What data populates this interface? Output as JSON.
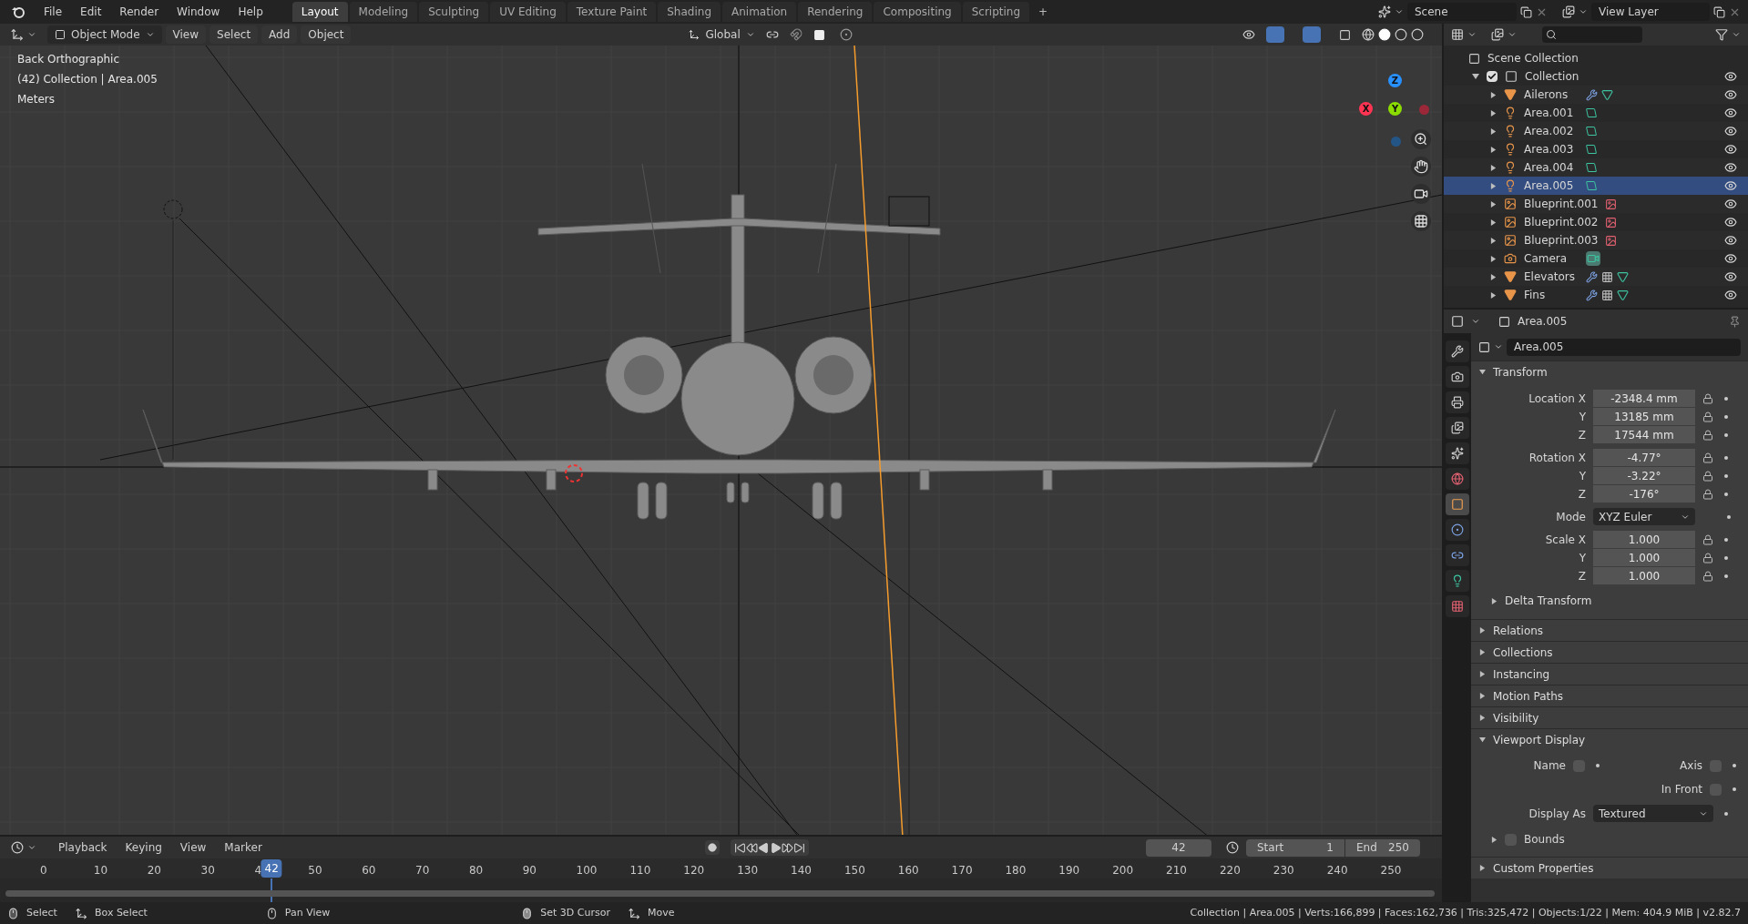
{
  "top_bar": {
    "menus": [
      "File",
      "Edit",
      "Render",
      "Window",
      "Help"
    ],
    "workspaces": [
      {
        "label": "Layout",
        "selected": true
      },
      {
        "label": "Modeling",
        "selected": false
      },
      {
        "label": "Sculpting",
        "selected": false
      },
      {
        "label": "UV Editing",
        "selected": false
      },
      {
        "label": "Texture Paint",
        "selected": false
      },
      {
        "label": "Shading",
        "selected": false
      },
      {
        "label": "Animation",
        "selected": false
      },
      {
        "label": "Rendering",
        "selected": false
      },
      {
        "label": "Compositing",
        "selected": false
      },
      {
        "label": "Scripting",
        "selected": false
      }
    ],
    "add_tab": "+",
    "scene": "Scene",
    "view_layer": "View Layer"
  },
  "viewport": {
    "mode": "Object Mode",
    "menus": [
      "View",
      "Select",
      "Add",
      "Object"
    ],
    "orientation": "Global",
    "overlay_text": [
      "Back Orthographic",
      "(42) Collection | Area.005",
      "Meters"
    ],
    "gizmo_axes": [
      "X",
      "Y",
      "Z"
    ]
  },
  "outliner": {
    "root": "Scene Collection",
    "collection": {
      "name": "Collection",
      "checked": true,
      "expanded": true,
      "children": [
        {
          "name": "Ailerons",
          "kind": "mesh",
          "selected": false,
          "visible": true
        },
        {
          "name": "Area.001",
          "kind": "light",
          "selected": false,
          "visible": true
        },
        {
          "name": "Area.002",
          "kind": "light",
          "selected": false,
          "visible": true
        },
        {
          "name": "Area.003",
          "kind": "light",
          "selected": false,
          "visible": true
        },
        {
          "name": "Area.004",
          "kind": "light",
          "selected": false,
          "visible": true
        },
        {
          "name": "Area.005",
          "kind": "light",
          "selected": true,
          "visible": true
        },
        {
          "name": "Blueprint.001",
          "kind": "image",
          "selected": false,
          "visible": true
        },
        {
          "name": "Blueprint.002",
          "kind": "image",
          "selected": false,
          "visible": true
        },
        {
          "name": "Blueprint.003",
          "kind": "image",
          "selected": false,
          "visible": true
        },
        {
          "name": "Camera",
          "kind": "camera",
          "selected": false,
          "visible": true
        },
        {
          "name": "Elevators",
          "kind": "mesh_mod",
          "selected": false,
          "visible": true
        },
        {
          "name": "Fins",
          "kind": "mesh_mod",
          "selected": false,
          "visible": true
        }
      ]
    }
  },
  "properties": {
    "object": "Area.005",
    "name_field": "Area.005",
    "tabs": [
      {
        "kind": "tool",
        "selected": false
      },
      {
        "kind": "render",
        "selected": false
      },
      {
        "kind": "output",
        "selected": false
      },
      {
        "kind": "view_layer",
        "selected": false
      },
      {
        "kind": "scene",
        "selected": false
      },
      {
        "kind": "world",
        "selected": false
      },
      {
        "kind": "object",
        "selected": true
      },
      {
        "kind": "physics",
        "selected": false
      },
      {
        "kind": "constraints",
        "selected": false
      },
      {
        "kind": "data",
        "selected": false
      },
      {
        "kind": "texture",
        "selected": false
      }
    ],
    "transform": {
      "title": "Transform",
      "expanded": true,
      "groups": [
        {
          "rows": [
            {
              "label": "Location X",
              "value": "-2348.4 mm"
            },
            {
              "label": "Y",
              "value": "13185 mm"
            },
            {
              "label": "Z",
              "value": "17544 mm"
            }
          ]
        },
        {
          "rows": [
            {
              "label": "Rotation X",
              "value": "-4.77°"
            },
            {
              "label": "Y",
              "value": "-3.22°"
            },
            {
              "label": "Z",
              "value": "-176°"
            }
          ]
        },
        {
          "mode_label": "Mode",
          "mode_value": "XYZ Euler"
        },
        {
          "rows": [
            {
              "label": "Scale X",
              "value": "1.000"
            },
            {
              "label": "Y",
              "value": "1.000"
            },
            {
              "label": "Z",
              "value": "1.000"
            }
          ]
        }
      ],
      "subpanel": {
        "title": "Delta Transform",
        "expanded": false
      }
    },
    "panels": [
      {
        "title": "Relations",
        "expanded": false
      },
      {
        "title": "Collections",
        "expanded": false
      },
      {
        "title": "Instancing",
        "expanded": false
      },
      {
        "title": "Motion Paths",
        "expanded": false
      },
      {
        "title": "Visibility",
        "expanded": false
      }
    ],
    "viewport_display": {
      "title": "Viewport Display",
      "expanded": true,
      "name": {
        "label": "Name",
        "checked": false
      },
      "axis": {
        "label": "Axis",
        "checked": false
      },
      "in_front": {
        "label": "In Front",
        "checked": false
      },
      "display_as": {
        "label": "Display As",
        "value": "Textured"
      },
      "bounds": {
        "label": "Bounds",
        "checked": false,
        "expanded": false
      }
    },
    "custom_properties": {
      "title": "Custom Properties",
      "expanded": false
    }
  },
  "timeline": {
    "menus": [
      "Playback",
      "Keying",
      "View",
      "Marker"
    ],
    "frame": "42",
    "start_label": "Start",
    "start": "1",
    "end_label": "End",
    "end": "250",
    "playhead_frame": "42",
    "ruler": [
      "0",
      "10",
      "20",
      "30",
      "4",
      "50",
      "60",
      "70",
      "80",
      "90",
      "100",
      "110",
      "120",
      "130",
      "140",
      "150",
      "160",
      "170",
      "180",
      "190",
      "200",
      "210",
      "220",
      "230",
      "240",
      "250"
    ]
  },
  "status_bar": {
    "hints": [
      {
        "kind": "mouse_left",
        "label": "Select"
      },
      {
        "kind": "mouse_drag",
        "label": "Box Select"
      },
      {
        "kind": "mouse_middle",
        "label": "Pan View"
      },
      {
        "kind": "mouse_right",
        "label": "Set 3D Cursor"
      },
      {
        "kind": "mouse_drag",
        "label": "Move"
      }
    ],
    "stats": "Collection | Area.005 | Verts:166,899 | Faces:162,736 | Tris:325,472 | Objects:1/22 | Mem: 404.9 MiB | v2.82.7"
  }
}
